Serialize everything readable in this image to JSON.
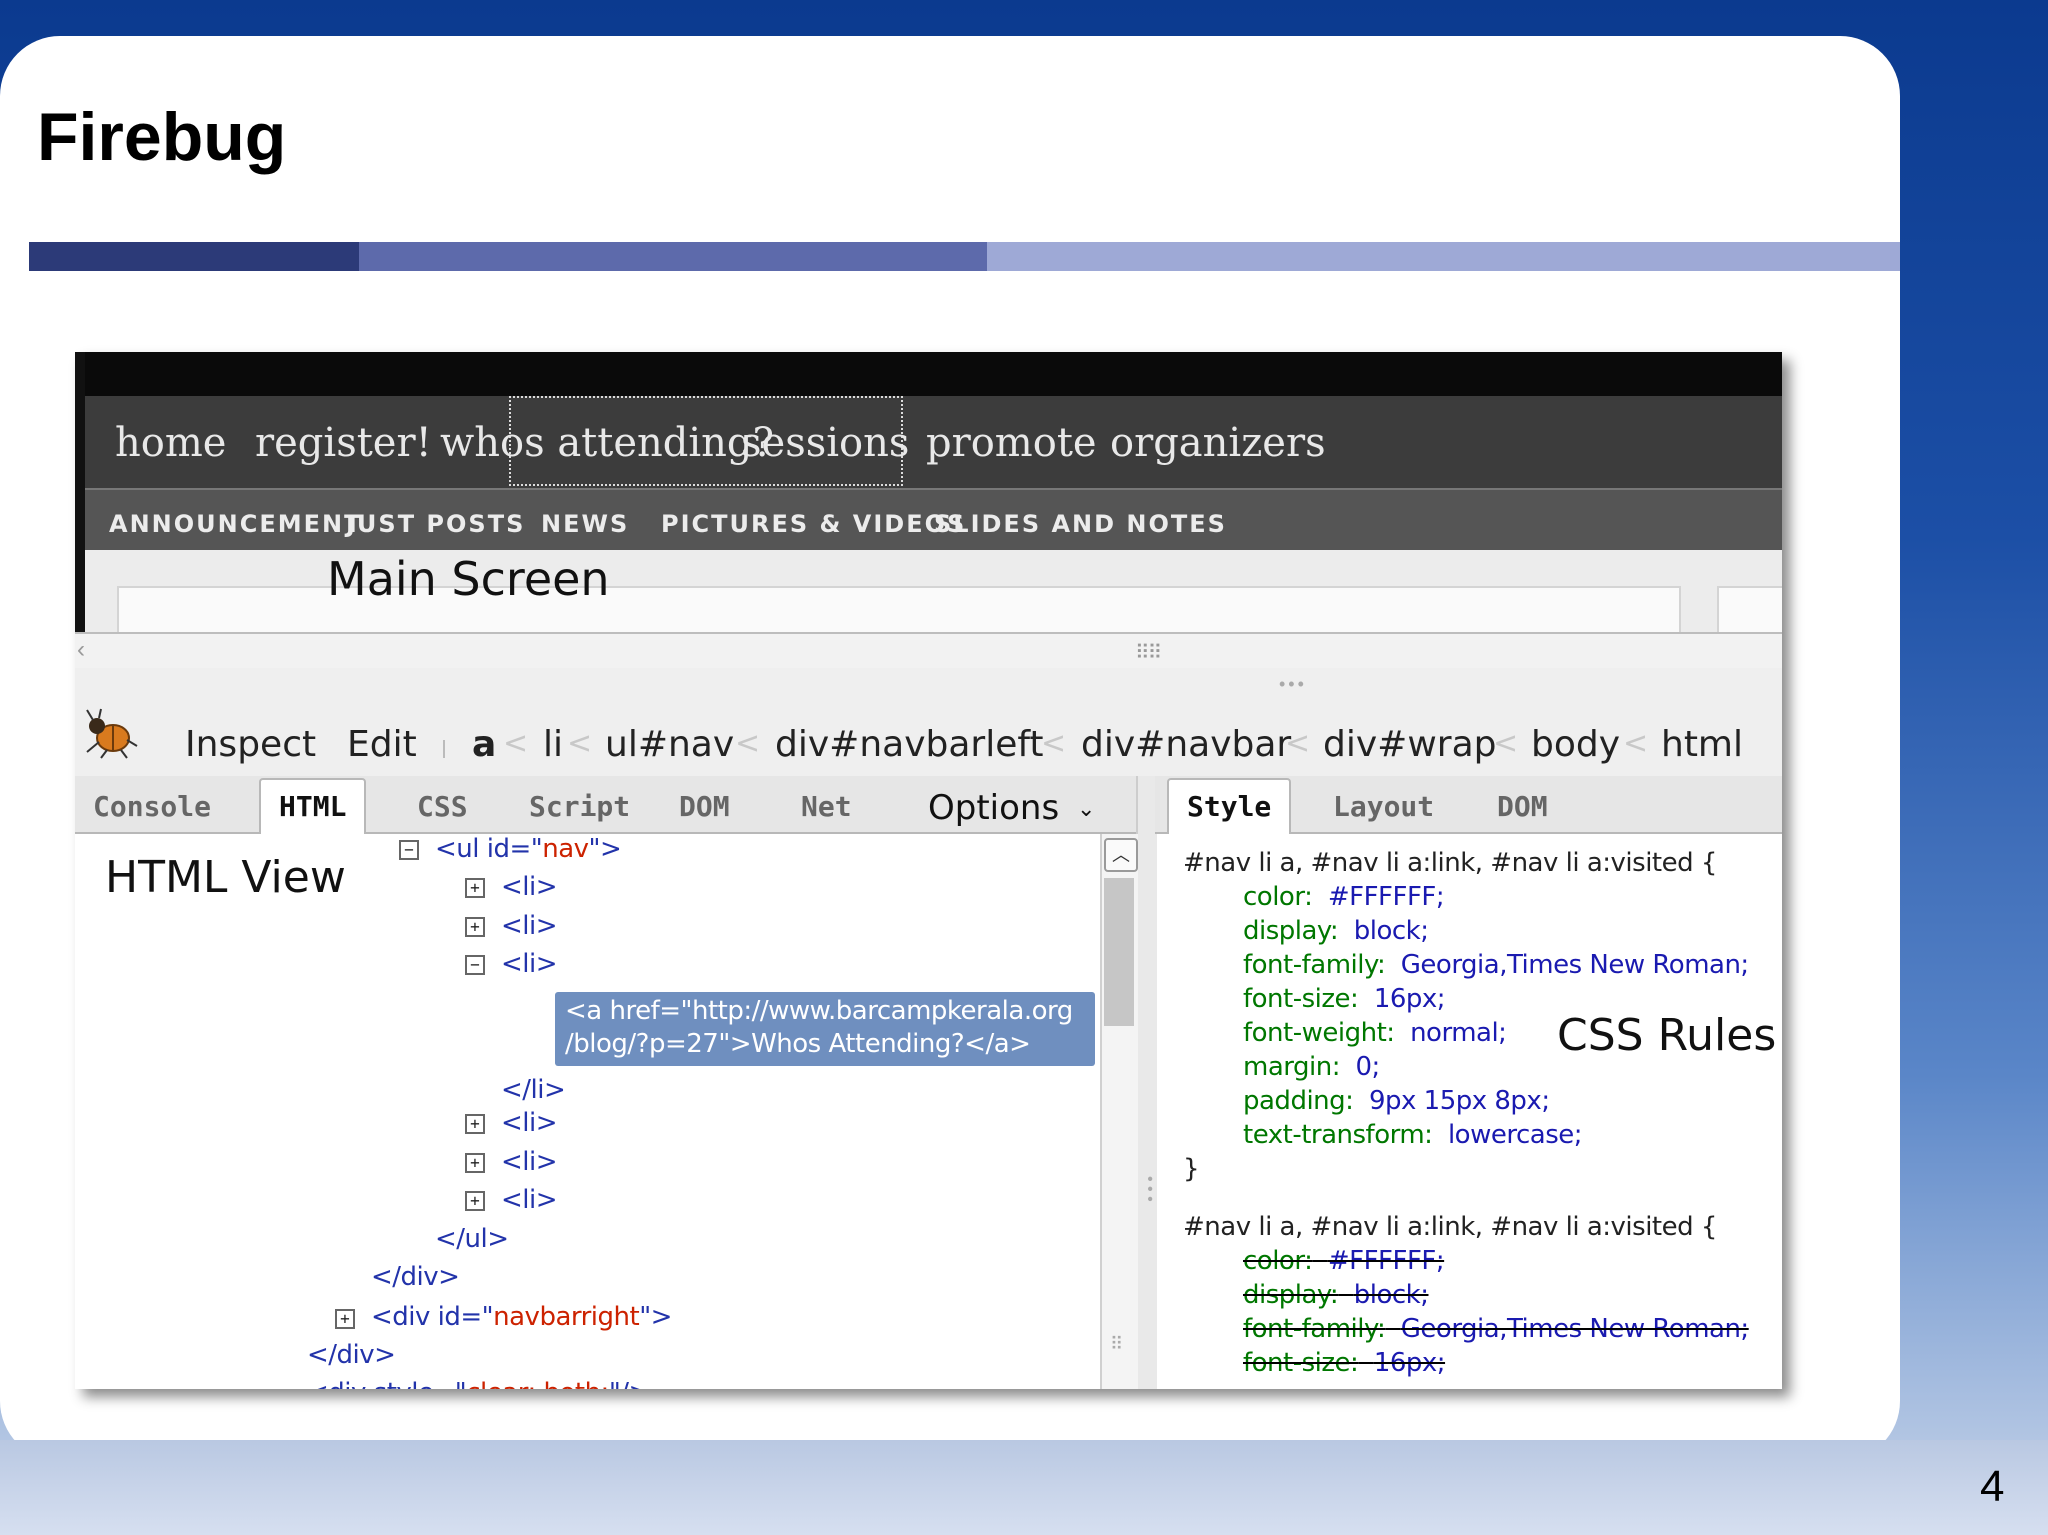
{
  "slide": {
    "title": "Firebug",
    "page_number": "4"
  },
  "site": {
    "nav": [
      "home",
      "register!",
      "whos attending?",
      "sessions",
      "promote",
      "organizers"
    ],
    "subnav": [
      "ANNOUNCEMENT",
      "JUST POSTS",
      "NEWS",
      "PICTURES & VIDEOS",
      "SLIDES AND NOTES"
    ],
    "main_screen_label": "Main Screen"
  },
  "firebug": {
    "toolbar": {
      "inspect": "Inspect",
      "edit": "Edit",
      "breadcrumbs": [
        "a",
        "li",
        "ul#nav",
        "div#navbarleft",
        "div#navbar",
        "div#wrap",
        "body",
        "html"
      ],
      "separator": "<"
    },
    "left_tabs": [
      "Console",
      "HTML",
      "CSS",
      "Script",
      "DOM",
      "Net"
    ],
    "active_left_tab": "HTML",
    "options": "Options",
    "right_tabs": [
      "Style",
      "Layout",
      "DOM"
    ],
    "active_right_tab": "Style",
    "html_view_label": "HTML View",
    "css_rules_label": "CSS Rules",
    "html_tree": {
      "ul_open_prefix": "<ul id=\"",
      "ul_id": "nav",
      "tag_suffix": "\">",
      "li": "<li>",
      "selected_line1": "<a href=\"http://www.barcampkerala.org",
      "selected_line2": "/blog/?p=27\">Whos Attending?</a>",
      "li_close": "</li>",
      "ul_close": "</ul>",
      "div_close": "</div>",
      "div_open_prefix": "<div id=\"",
      "div_id": "navbarright",
      "div_style_prefix": "<div style=\"",
      "div_style_value": "clear: both;",
      "div_style_suffix": "\"/>"
    },
    "css": {
      "rule1_selector": "#nav li a, #nav li a:link, #nav li a:visited {",
      "rule1_props": [
        {
          "p": "color:",
          "v": "#FFFFFF;"
        },
        {
          "p": "display:",
          "v": "block;"
        },
        {
          "p": "font-family:",
          "v": "Georgia,Times New Roman;"
        },
        {
          "p": "font-size:",
          "v": "16px;"
        },
        {
          "p": "font-weight:",
          "v": "normal;"
        },
        {
          "p": "margin:",
          "v": "0;"
        },
        {
          "p": "padding:",
          "v": "9px 15px 8px;"
        },
        {
          "p": "text-transform:",
          "v": "lowercase;"
        }
      ],
      "rule1_close": "}",
      "rule2_selector": "#nav li a, #nav li a:link, #nav li a:visited {",
      "rule2_props": [
        {
          "p": "color:",
          "v": "#FFFFFF;"
        },
        {
          "p": "display:",
          "v": "block;"
        },
        {
          "p": "font-family:",
          "v": "Georgia,Times New Roman;"
        },
        {
          "p": "font-size:",
          "v": "16px;"
        }
      ]
    }
  },
  "colors": {
    "slide_background": "#0b3a8f",
    "title_bar_dark": "#2c3a78",
    "title_bar_mid": "#5d6aab",
    "title_bar_light": "#9ea9d6",
    "navbar": "#3c3c3c",
    "selected_node": "#6f8fbf",
    "css_property": "#007700",
    "css_value": "#1a1ab0",
    "html_tag": "#2233aa",
    "html_attr": "#cc2200"
  },
  "icons": {
    "firebug_logo": "firebug-bug-icon",
    "expand": "plus-box-icon",
    "collapse": "minus-box-icon",
    "scroll_up": "chevron-up-icon",
    "options_caret": "chevron-down-icon"
  }
}
